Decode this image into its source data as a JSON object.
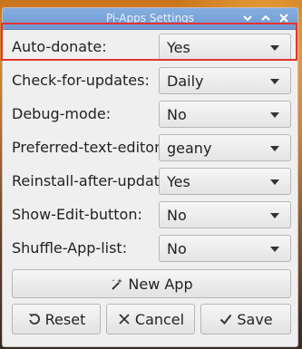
{
  "window": {
    "title": "Pi-Apps Settings",
    "minimize_icon": "chevron-down-icon",
    "maximize_icon": "chevron-up-icon",
    "close_icon": "close-icon"
  },
  "settings": [
    {
      "label": "Auto-donate:",
      "value": "Yes"
    },
    {
      "label": "Check-for-updates:",
      "value": "Daily"
    },
    {
      "label": "Debug-mode:",
      "value": "No"
    },
    {
      "label": "Preferred-text-editor:",
      "value": "geany"
    },
    {
      "label": "Reinstall-after-update:",
      "value": "Yes"
    },
    {
      "label": "Show-Edit-button:",
      "value": "No"
    },
    {
      "label": "Shuffle-App-list:",
      "value": "No"
    }
  ],
  "buttons": {
    "new_app": "New App",
    "reset": "Reset",
    "cancel": "Cancel",
    "save": "Save"
  },
  "colors": {
    "titlebar": "#7aa3d8",
    "highlight": "#e2342f",
    "window_bg": "#efefef"
  }
}
